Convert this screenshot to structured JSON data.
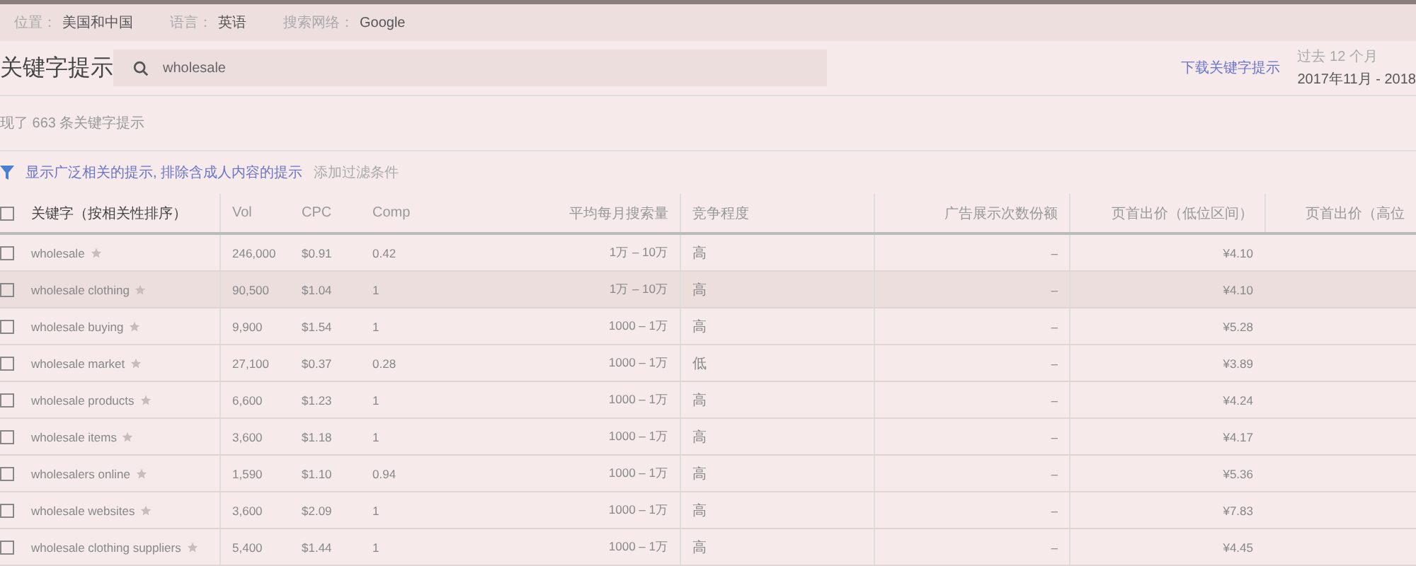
{
  "top_bar": [
    {
      "label": "位置：",
      "value": "美国和中国"
    },
    {
      "label": "语言：",
      "value": "英语"
    },
    {
      "label": "搜索网络：",
      "value": "Google"
    }
  ],
  "title": "关键字提示",
  "search": {
    "value": "wholesale"
  },
  "download_link": "下载关键字提示",
  "date_range": {
    "label": "过去 12 个月",
    "value": "2017年11月 - 2018"
  },
  "result_count": "现了 663 条关键字提示",
  "filters": {
    "active": "显示广泛相关的提示, 排除含成人内容的提示",
    "add": "添加过滤条件"
  },
  "table": {
    "select_all": {
      "checked": false
    },
    "columns": [
      "关键字（按相关性排序）",
      "Vol",
      "CPC",
      "Comp",
      "平均每月搜索量",
      "竞争程度",
      "广告展示次数份额",
      "页首出价（低位区间）",
      "页首出价（高位"
    ],
    "rows": [
      {
        "checked": false,
        "highlighted": false,
        "cells": [
          "wholesale",
          "246,000",
          "$0.91",
          "0.42",
          "1万 – 10万",
          "高",
          "–",
          "¥4.10"
        ]
      },
      {
        "checked": false,
        "highlighted": true,
        "cells": [
          "wholesale clothing",
          "90,500",
          "$1.04",
          "1",
          "1万 – 10万",
          "高",
          "–",
          "¥4.10"
        ]
      },
      {
        "checked": false,
        "highlighted": false,
        "cells": [
          "wholesale buying",
          "9,900",
          "$1.54",
          "1",
          "1000 – 1万",
          "高",
          "–",
          "¥5.28"
        ]
      },
      {
        "checked": false,
        "highlighted": false,
        "cells": [
          "wholesale market",
          "27,100",
          "$0.37",
          "0.28",
          "1000 – 1万",
          "低",
          "–",
          "¥3.89"
        ]
      },
      {
        "checked": false,
        "highlighted": false,
        "cells": [
          "wholesale products",
          "6,600",
          "$1.23",
          "1",
          "1000 – 1万",
          "高",
          "–",
          "¥4.24"
        ]
      },
      {
        "checked": false,
        "highlighted": false,
        "cells": [
          "wholesale items",
          "3,600",
          "$1.18",
          "1",
          "1000 – 1万",
          "高",
          "–",
          "¥4.17"
        ]
      },
      {
        "checked": false,
        "highlighted": false,
        "cells": [
          "wholesalers online",
          "1,590",
          "$1.10",
          "0.94",
          "1000 – 1万",
          "高",
          "–",
          "¥5.36"
        ]
      },
      {
        "checked": false,
        "highlighted": false,
        "cells": [
          "wholesale websites",
          "3,600",
          "$2.09",
          "1",
          "1000 – 1万",
          "高",
          "–",
          "¥7.83"
        ]
      },
      {
        "checked": false,
        "highlighted": false,
        "cells": [
          "wholesale clothing suppliers",
          "5,400",
          "$1.44",
          "1",
          "1000 – 1万",
          "高",
          "–",
          "¥4.45"
        ]
      }
    ]
  }
}
